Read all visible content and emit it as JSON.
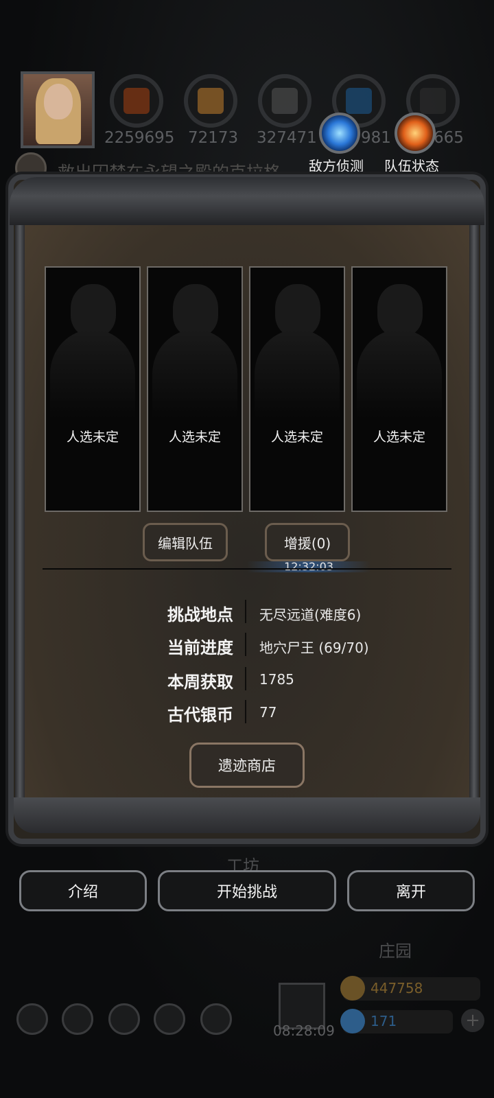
{
  "resources": [
    {
      "icon": "ore-icon",
      "value": "2259695"
    },
    {
      "icon": "wood-icon",
      "value": "72173"
    },
    {
      "icon": "iron-icon",
      "value": "327471"
    },
    {
      "icon": "crystal-icon",
      "value": "981"
    },
    {
      "icon": "coal-icon",
      "value": "665"
    }
  ],
  "quest_text": "救出囚禁在永望之殿的克拉格",
  "top_buttons": {
    "enemy_scout": "敌方侦测",
    "team_status": "队伍状态"
  },
  "slots": [
    "人选未定",
    "人选未定",
    "人选未定",
    "人选未定"
  ],
  "edit_team": "编辑队伍",
  "reinforce": "增援(0)",
  "timer": "12:32:03",
  "info": [
    {
      "label": "挑战地点",
      "value": "无尽远道(难度6)"
    },
    {
      "label": "当前进度",
      "value": "地穴尸王 (69/70)"
    },
    {
      "label": "本周获取",
      "value": "1785"
    },
    {
      "label": "古代银币",
      "value": "77"
    }
  ],
  "shop_button": "遗迹商店",
  "bottom_buttons": {
    "intro": "介绍",
    "start": "开始挑战",
    "leave": "离开"
  },
  "town": {
    "workshop": "工坊",
    "manor": "庄园"
  },
  "gift_timer": "08:28:09",
  "currency": {
    "gold": "447758",
    "gems": "171"
  },
  "colors": {
    "gold": "#7a5e2a",
    "gem": "#2d5d8a"
  }
}
